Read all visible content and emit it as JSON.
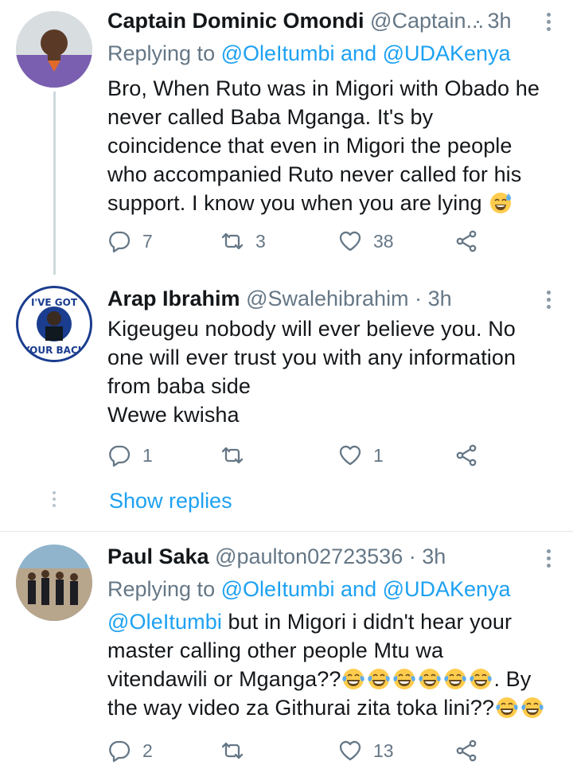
{
  "tweets": [
    {
      "name": "Captain Dominic Omondi",
      "handle": "@Captain...",
      "time": "· 3h",
      "replying_prefix": "Replying to ",
      "replying_to": "@OleItumbi and @UDAKenya",
      "body_lines": [
        "Bro, When Ruto was in Migori with Obado he",
        "never called Baba Mganga. It's by",
        "coincidence that even in Migori the people",
        "who accompanied Ruto never called for his",
        "support. I know you when you are lying"
      ],
      "replies": "7",
      "retweets": "3",
      "likes": "38"
    },
    {
      "name": "Arap Ibrahim",
      "handle": "@Swalehibrahim",
      "time": "· 3h",
      "body_lines": [
        "Kigeugeu nobody will ever believe you. No",
        "one will ever trust you with any information",
        "from baba side",
        "Wewe kwisha"
      ],
      "replies": "1",
      "retweets": "",
      "likes": "1",
      "avatar_text": [
        "I'VE GOT",
        "YOUR BACK"
      ]
    },
    {
      "name": "Paul Saka",
      "handle": "@paulton02723536",
      "time": "· 3h",
      "replying_prefix": "Replying to ",
      "replying_to": "@OleItumbi and @UDAKenya",
      "body_mention": "@OleItumbi",
      "body_line1_rest": " but in Migori i didn't hear your",
      "body_line2": "master calling other people Mtu wa",
      "body_line3": "vitendawili or Mganga??",
      "body_line3_tail": ". By",
      "body_line4": "the way video za Githurai zita toka lini??",
      "replies": "2",
      "retweets": "",
      "likes": "13"
    }
  ],
  "show_replies": "Show replies",
  "colors": {
    "link": "#1da1f2",
    "muted": "#657786",
    "text": "#14171a"
  },
  "icons": [
    "reply-icon",
    "retweet-icon",
    "like-icon",
    "share-icon",
    "more-icon",
    "laughing-tears-emoji",
    "sweat-smile-emoji"
  ]
}
